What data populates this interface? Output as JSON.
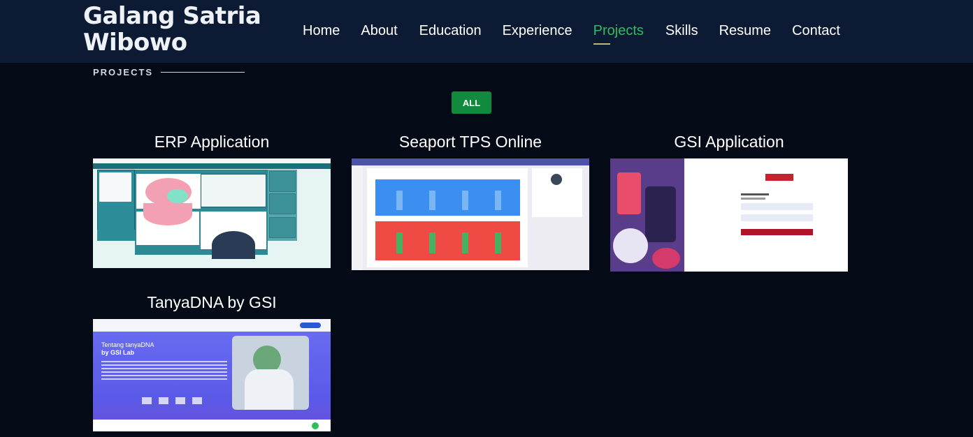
{
  "header": {
    "brand_line1": "Galang Satria",
    "brand_line2": "Wibowo",
    "nav": [
      {
        "label": "Home",
        "active": false
      },
      {
        "label": "About",
        "active": false
      },
      {
        "label": "Education",
        "active": false
      },
      {
        "label": "Experience",
        "active": false
      },
      {
        "label": "Projects",
        "active": true
      },
      {
        "label": "Skills",
        "active": false
      },
      {
        "label": "Resume",
        "active": false
      },
      {
        "label": "Contact",
        "active": false
      }
    ]
  },
  "section": {
    "label": "PROJECTS"
  },
  "filter": {
    "all_label": "ALL"
  },
  "projects": [
    {
      "title": "ERP Application"
    },
    {
      "title": "Seaport TPS Online"
    },
    {
      "title": "GSI Application"
    },
    {
      "title": "TanyaDNA by GSI"
    }
  ],
  "colors": {
    "header_bg": "#0c1b33",
    "page_bg": "#040b17",
    "accent_green": "#2ebc61",
    "button_green": "#128a3d"
  },
  "thumbs": {
    "dna_heading_line1": "Tentang tanyaDNA",
    "dna_heading_line2": "by GSI Lab"
  }
}
